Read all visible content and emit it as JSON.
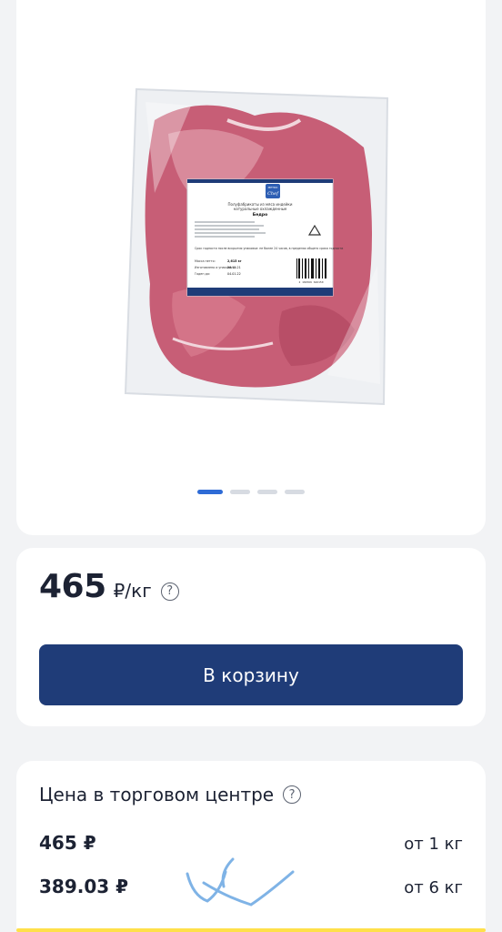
{
  "gallery": {
    "label": {
      "brand_top": "METRO",
      "brand": "Chef",
      "title_line1": "Полуфабрикаты из мяса индейки",
      "title_line2": "натуральные охлажденные",
      "title_line3": "Бедро",
      "storage_text": "Срок годности после вскрытия упаковки: не более 24 часов, в пределах общего срока годности",
      "net_weight_label": "Масса нетто:",
      "net_weight": "2,615 кг",
      "packed_label": "Изготовлено и упаковано:",
      "packed_date": "26.12.21",
      "use_by_label": "Годен до:",
      "use_by_date": "04.01.22",
      "barcode_number": "2 102566 626150"
    },
    "total_images": 4,
    "active_image": 1
  },
  "price": {
    "value": "465",
    "unit": "₽/кг",
    "help_glyph": "?"
  },
  "cart_button": {
    "label": "В корзину"
  },
  "store_prices": {
    "title": "Цена в торговом центре",
    "help_glyph": "?",
    "tiers": [
      {
        "price": "465 ₽",
        "quantity": "от 1 кг"
      },
      {
        "price": "389.03 ₽",
        "quantity": "от 6 кг"
      }
    ]
  },
  "colors": {
    "accent": "#2e6bd6",
    "button": "#1f3c78",
    "background": "#f2f3f5",
    "scribble": "#7fb3e6"
  }
}
